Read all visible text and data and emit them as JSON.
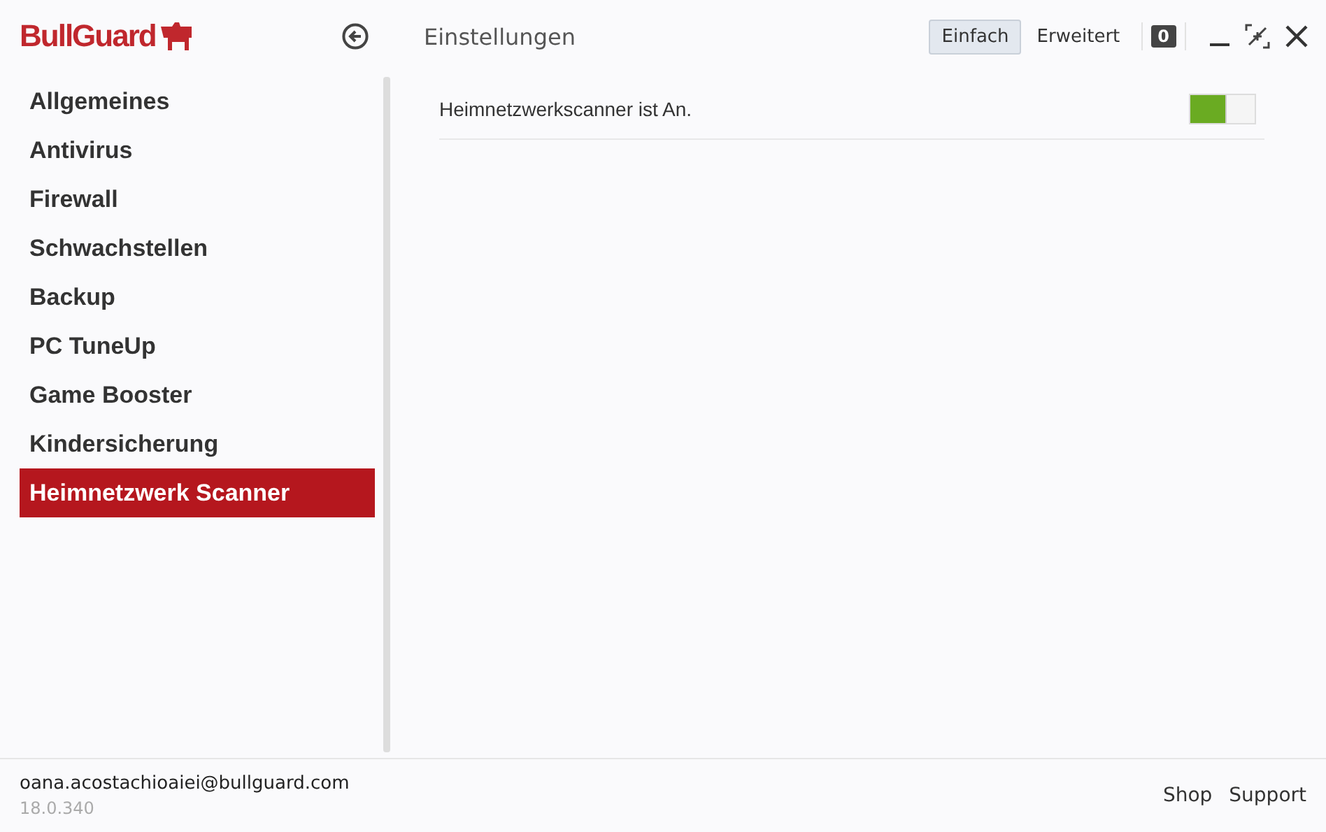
{
  "app": {
    "logo": "BullGuard",
    "title": "Einstellungen"
  },
  "modes": [
    {
      "label": "Einfach",
      "selected": true
    },
    {
      "label": "Erweitert",
      "selected": false
    }
  ],
  "notifications": {
    "count": "0"
  },
  "sidebar": {
    "items": [
      {
        "label": "Allgemeines",
        "selected": false
      },
      {
        "label": "Antivirus",
        "selected": false
      },
      {
        "label": "Firewall",
        "selected": false
      },
      {
        "label": "Schwachstellen",
        "selected": false
      },
      {
        "label": "Backup",
        "selected": false
      },
      {
        "label": "PC TuneUp",
        "selected": false
      },
      {
        "label": "Game Booster",
        "selected": false
      },
      {
        "label": "Kindersicherung",
        "selected": false
      },
      {
        "label": "Heimnetzwerk Scanner",
        "selected": true
      }
    ]
  },
  "settings": [
    {
      "label": "Heimnetzwerkscanner ist An.",
      "on": true
    }
  ],
  "footer": {
    "account": "oana.acostachioaiei@bullguard.com",
    "version": "18.0.340",
    "links": [
      "Shop",
      "Support"
    ]
  }
}
